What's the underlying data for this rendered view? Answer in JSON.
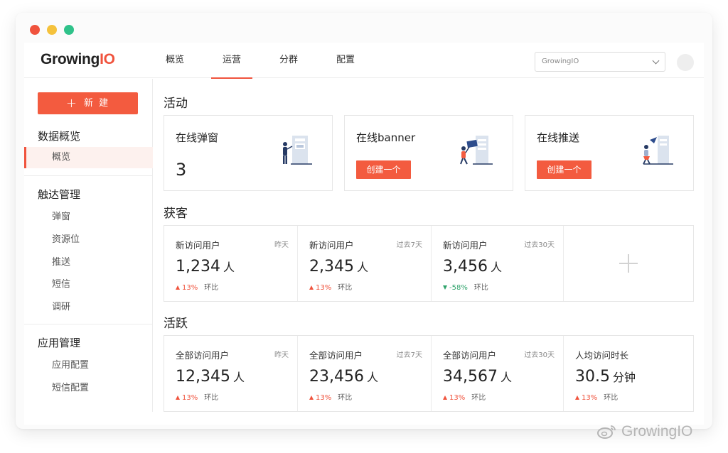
{
  "colors": {
    "accent": "#f35b3f",
    "up": "#f0533d",
    "down": "#2fa36b"
  },
  "header": {
    "logo_prefix": "Growing",
    "logo_suffix": "IO",
    "nav": [
      "概览",
      "运营",
      "分群",
      "配置"
    ],
    "active_nav": "运营",
    "org_select_value": "GrowingIO"
  },
  "sidebar": {
    "new_button_label": "新 建",
    "groups": [
      {
        "title": "数据概览",
        "items": [
          "概览"
        ]
      },
      {
        "title": "触达管理",
        "items": [
          "弹窗",
          "资源位",
          "推送",
          "短信",
          "调研"
        ]
      },
      {
        "title": "应用管理",
        "items": [
          "应用配置",
          "短信配置"
        ]
      }
    ],
    "active_item": "概览"
  },
  "sections": {
    "activity": {
      "title": "活动",
      "cards": [
        {
          "title": "在线弹窗",
          "count": "3",
          "illustration": "popup-illustration"
        },
        {
          "title": "在线banner",
          "button": "创建一个",
          "illustration": "banner-illustration"
        },
        {
          "title": "在线推送",
          "button": "创建一个",
          "illustration": "push-illustration"
        }
      ]
    },
    "acquisition": {
      "title": "获客",
      "stats": [
        {
          "label": "新访问用户",
          "period": "昨天",
          "value": "1,234",
          "unit": "人",
          "change": "13%",
          "direction": "up",
          "compare": "环比"
        },
        {
          "label": "新访问用户",
          "period": "过去7天",
          "value": "2,345",
          "unit": "人",
          "change": "13%",
          "direction": "up",
          "compare": "环比"
        },
        {
          "label": "新访问用户",
          "period": "过去30天",
          "value": "3,456",
          "unit": "人",
          "change": "-58%",
          "direction": "down",
          "compare": "环比"
        }
      ],
      "add_icon": "plus-icon"
    },
    "engagement": {
      "title": "活跃",
      "stats": [
        {
          "label": "全部访问用户",
          "period": "昨天",
          "value": "12,345",
          "unit": "人",
          "change": "13%",
          "direction": "up",
          "compare": "环比"
        },
        {
          "label": "全部访问用户",
          "period": "过去7天",
          "value": "23,456",
          "unit": "人",
          "change": "13%",
          "direction": "up",
          "compare": "环比"
        },
        {
          "label": "全部访问用户",
          "period": "过去30天",
          "value": "34,567",
          "unit": "人",
          "change": "13%",
          "direction": "up",
          "compare": "环比"
        },
        {
          "label": "人均访问时长",
          "period": "",
          "value": "30.5",
          "unit": "分钟",
          "change": "13%",
          "direction": "up",
          "compare": "环比"
        }
      ]
    }
  },
  "watermark": "GrowingIO"
}
